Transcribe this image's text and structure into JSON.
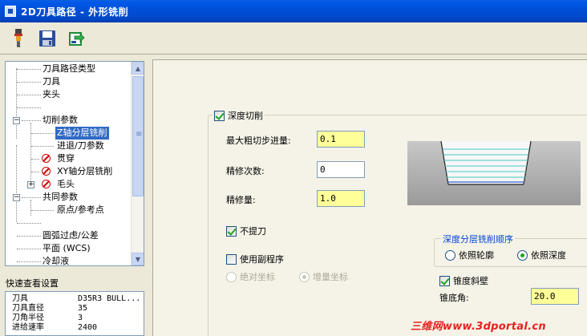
{
  "window": {
    "title": "2D刀具路径 - 外形铣削"
  },
  "toolbar": {
    "buttons": [
      "tool-holder-icon",
      "save-icon",
      "export-icon"
    ]
  },
  "tree": {
    "items": [
      {
        "label": "刀具路径类型"
      },
      {
        "label": "刀具"
      },
      {
        "label": "夹头"
      },
      {
        "label": ""
      },
      {
        "label": "切削参数",
        "expander": "−"
      },
      {
        "label": "Z轴分层铣削",
        "selected": true
      },
      {
        "label": "进退/刀参数"
      },
      {
        "label": "贯穿",
        "icon": "disabled-icon"
      },
      {
        "label": "XY轴分层铣削",
        "icon": "disabled-icon"
      },
      {
        "label": "毛头",
        "icon": "disabled-icon",
        "expander": "+"
      },
      {
        "label": "共同参数",
        "expander": "−"
      },
      {
        "label": "原点/参考点"
      },
      {
        "label": ""
      },
      {
        "label": "圆弧过虑/公差"
      },
      {
        "label": "平面 (WCS)"
      },
      {
        "label": "冷却液"
      }
    ]
  },
  "quick_view": {
    "title": "快速查看设置",
    "rows": [
      {
        "key": "刀具",
        "value": "D35R3 BULL..."
      },
      {
        "key": "刀具直径",
        "value": "35"
      },
      {
        "key": "刀角半径",
        "value": "3"
      },
      {
        "key": "进给速率",
        "value": "2400"
      }
    ]
  },
  "depth_cut": {
    "enabled_label": "深度切削",
    "max_rough_step_label": "最大粗切步进量:",
    "max_rough_step_value": "0.1",
    "finish_count_label": "精修次数:",
    "finish_count_value": "0",
    "finish_amount_label": "精修量:",
    "finish_amount_value": "1.0",
    "no_retract_label": "不提刀",
    "use_subprogram_label": "使用副程序",
    "absolute_label": "绝对坐标",
    "incremental_label": "增量坐标",
    "order_group_label": "深度分层铣削顺序",
    "by_contour_label": "依照轮廓",
    "by_depth_label": "依照深度",
    "taper_wall_label": "锥度斜壁",
    "taper_angle_label": "锥底角:",
    "taper_angle_value": "20.0"
  },
  "watermark": "三维网www.3dportal.cn",
  "colors": {
    "title_bar": "#0050D8",
    "selection": "#316AC5",
    "highlight_field": "#FFFF99",
    "group_title": "#0046D5"
  }
}
